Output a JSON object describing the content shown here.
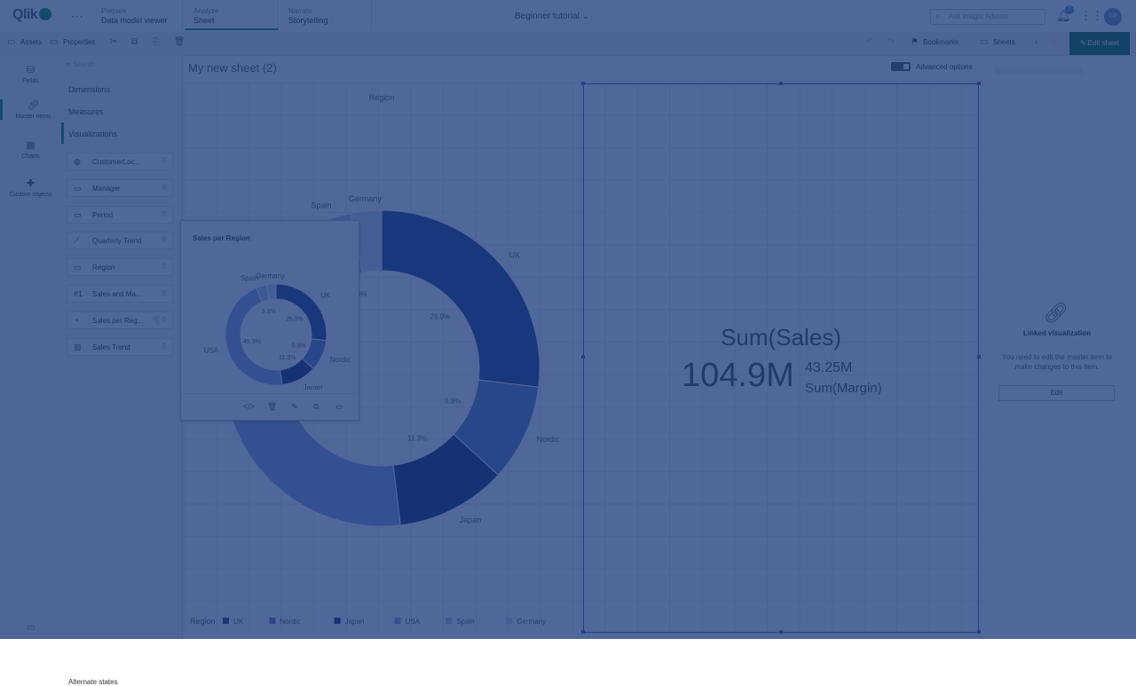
{
  "topbar": {
    "brand": "Qlik",
    "tabs": [
      {
        "small": "Prepare",
        "big": "Data model viewer"
      },
      {
        "small": "Analyze",
        "big": "Sheet"
      },
      {
        "small": "Narrate",
        "big": "Storytelling"
      }
    ],
    "app_title": "Beginner tutorial",
    "insight_placeholder": "Ask Insight Advisor",
    "notification_count": "2",
    "avatar_initials": "GP"
  },
  "toolbar": {
    "assets_label": "Assets",
    "properties_label": "Properties",
    "bookmarks_label": "Bookmarks",
    "sheets_label": "Sheets",
    "edit_sheet_label": "Edit sheet"
  },
  "rail": {
    "items": [
      {
        "label": "Fields",
        "icon": "database-icon"
      },
      {
        "label": "Master items",
        "icon": "link-icon"
      },
      {
        "label": "Charts",
        "icon": "chart-icon"
      },
      {
        "label": "Custom objects",
        "icon": "puzzle-icon"
      }
    ]
  },
  "assets": {
    "search_placeholder": "Search",
    "sections": [
      "Dimensions",
      "Measures",
      "Visualizations"
    ],
    "viz_items": [
      {
        "label": "CustomerLoc...",
        "icon": "globe-icon"
      },
      {
        "label": "Manager",
        "icon": "filter-pane-icon"
      },
      {
        "label": "Period",
        "icon": "filter-pane-icon"
      },
      {
        "label": "Quarterly Trend",
        "icon": "line-chart-icon"
      },
      {
        "label": "Region",
        "icon": "filter-pane-icon"
      },
      {
        "label": "Sales and Ma...",
        "icon": "kpi-icon"
      },
      {
        "label": "Sales per Reg...",
        "icon": "pie-icon"
      },
      {
        "label": "Sales Trend",
        "icon": "combo-chart-icon"
      }
    ],
    "alternate_states": "Alternate states"
  },
  "sheet": {
    "title": "My new sheet (2)",
    "advanced_options": "Advanced options"
  },
  "kpi": {
    "title": "Sum(Sales)",
    "value": "104.9M",
    "secondary_value": "43.25M",
    "secondary_label": "Sum(Margin)"
  },
  "linked": {
    "title": "Linked visualization",
    "text": "You need to edit the master item to make changes to this item.",
    "edit_label": "Edit"
  },
  "popup": {
    "title": "Sales per Region"
  },
  "chart_data": {
    "type": "pie",
    "title": "Region",
    "categories": [
      "UK",
      "Nordic",
      "Japan",
      "USA",
      "Spain",
      "Germany"
    ],
    "values": [
      26.9,
      9.9,
      11.3,
      45.5,
      3.3,
      3.1
    ],
    "labels": [
      "26.9%",
      "9.9%",
      "11.3%",
      "45.5%",
      "3.3%",
      ""
    ],
    "colors": [
      "#26408a",
      "#5e7fc0",
      "#1b2f6b",
      "#8ea4d6",
      "#b7c4e4",
      "#d2dbef"
    ],
    "legend_title": "Region",
    "legend_position": "bottom"
  }
}
